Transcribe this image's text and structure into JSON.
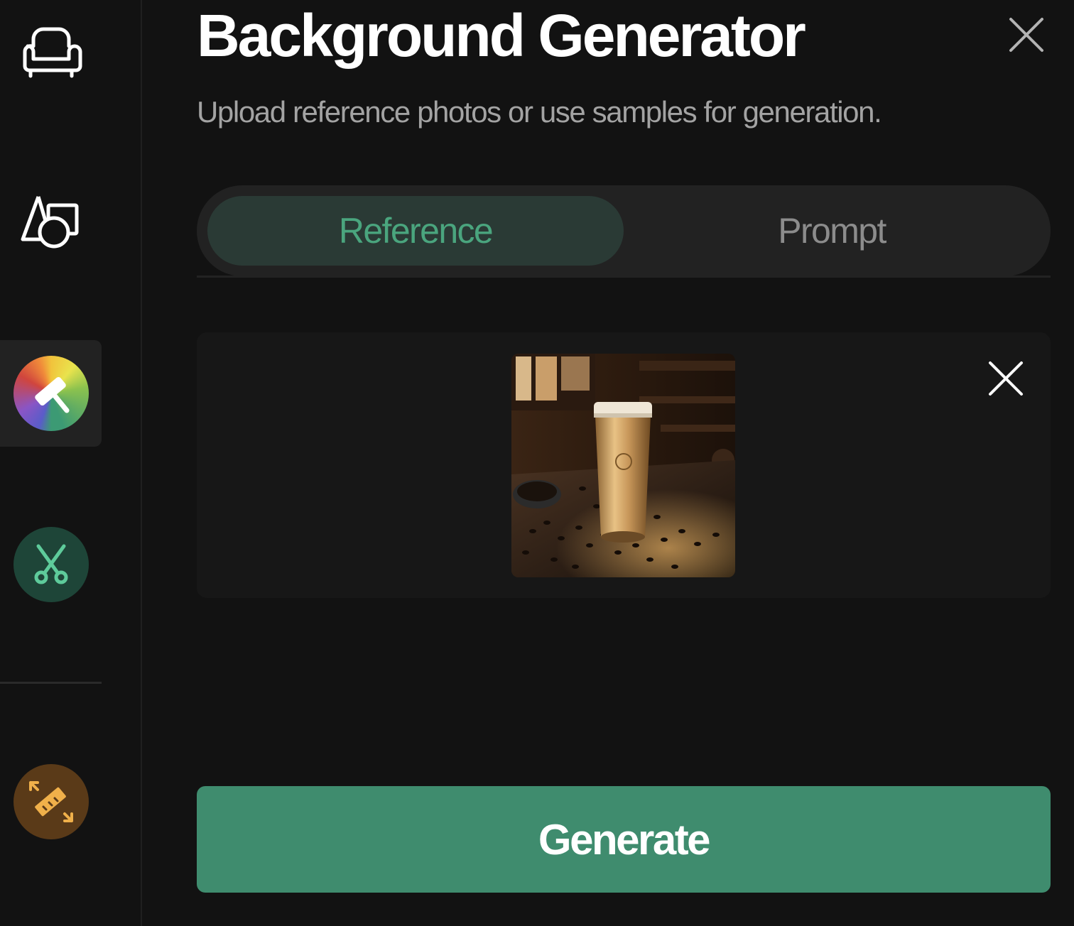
{
  "sidebar": {
    "items": [
      {
        "icon": "sofa-icon",
        "active": false
      },
      {
        "icon": "shapes-icon",
        "active": false
      },
      {
        "icon": "background-generator-icon",
        "active": true
      },
      {
        "icon": "scissors-icon",
        "active": false
      },
      {
        "icon": "resize-ruler-icon",
        "active": false
      }
    ]
  },
  "header": {
    "title": "Background Generator",
    "subtitle": "Upload reference photos or use samples for generation."
  },
  "tabs": [
    {
      "label": "Reference",
      "active": true
    },
    {
      "label": "Prompt",
      "active": false
    }
  ],
  "reference": {
    "image_icon": "coffee-tumbler-photo"
  },
  "actions": {
    "generate_label": "Generate"
  },
  "colors": {
    "background": "#121212",
    "accent": "#3f8c6e",
    "active_tab_text": "#4aa57e",
    "scissors_bg": "#1e4538",
    "resize_bg": "#5a3a18"
  }
}
